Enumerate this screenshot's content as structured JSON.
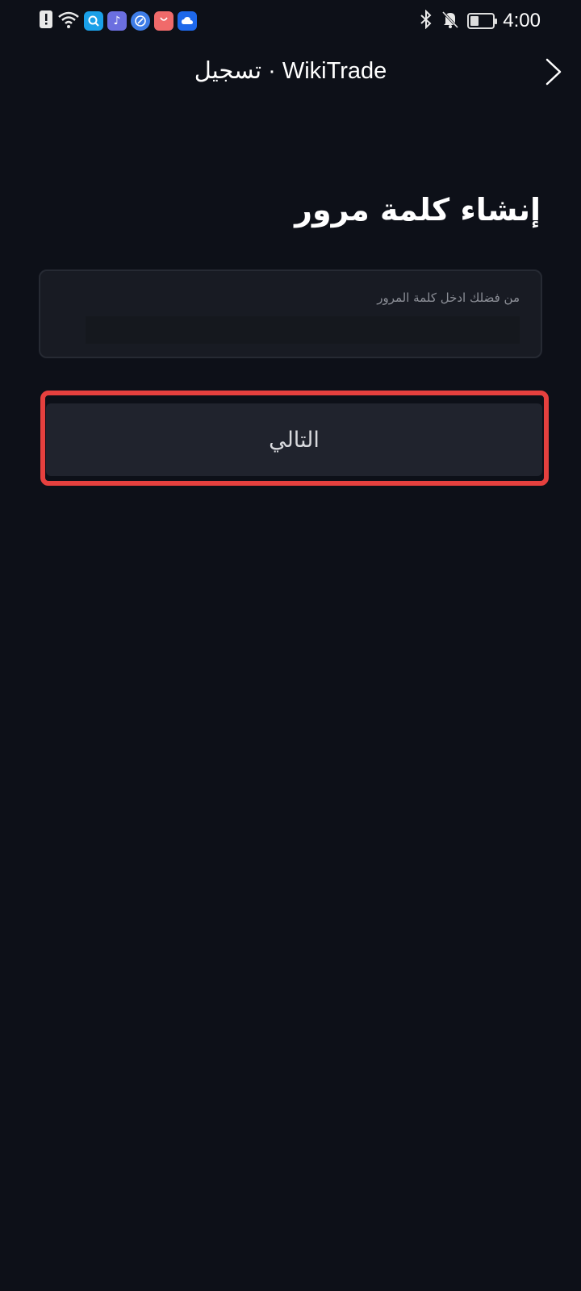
{
  "status_bar": {
    "time": "4:00",
    "battery_level": 0.4,
    "left_icons": [
      "alert-icon",
      "wifi-icon",
      "search-app-icon",
      "music-app-icon",
      "browser-app-icon",
      "shop-app-icon",
      "cloud-app-icon"
    ],
    "right_icons": [
      "bluetooth-icon",
      "bell-off-icon",
      "battery-icon"
    ]
  },
  "header": {
    "title": "تسجيل · WikiTrade",
    "back_icon": "chevron-right-icon"
  },
  "main": {
    "title": "إنشاء كلمة مرور",
    "password_field": {
      "label": "من فضلك ادخل كلمة المرور",
      "value": ""
    },
    "next_button_label": "التالي"
  },
  "colors": {
    "background": "#0d1018",
    "field_bg": "#181b23",
    "button_bg": "#20232d",
    "highlight": "#e5403e"
  }
}
